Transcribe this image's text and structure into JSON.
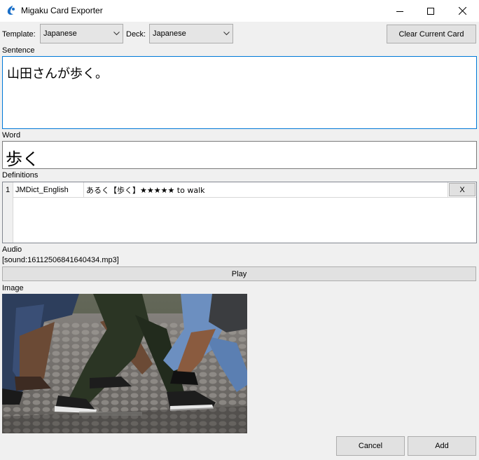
{
  "window": {
    "title": "Migaku Card Exporter",
    "accent": "#1a6fc8"
  },
  "toolbar": {
    "template_label": "Template:",
    "template_value": "Japanese",
    "deck_label": "Deck:",
    "deck_value": "Japanese",
    "clear_button": "Clear Current Card"
  },
  "sentence": {
    "label": "Sentence",
    "value": "山田さんが歩く。"
  },
  "word": {
    "label": "Word",
    "value": "歩く"
  },
  "definitions": {
    "label": "Definitions",
    "rows": [
      {
        "index": "1",
        "dictionary": "JMDict_English",
        "definition": "あるく【歩く】★★★★★ to walk",
        "remove_label": "X"
      }
    ]
  },
  "audio": {
    "label": "Audio",
    "file": "[sound:16112506841640434.mp3]",
    "play_button": "Play"
  },
  "image": {
    "label": "Image"
  },
  "footer": {
    "cancel_button": "Cancel",
    "add_button": "Add"
  }
}
